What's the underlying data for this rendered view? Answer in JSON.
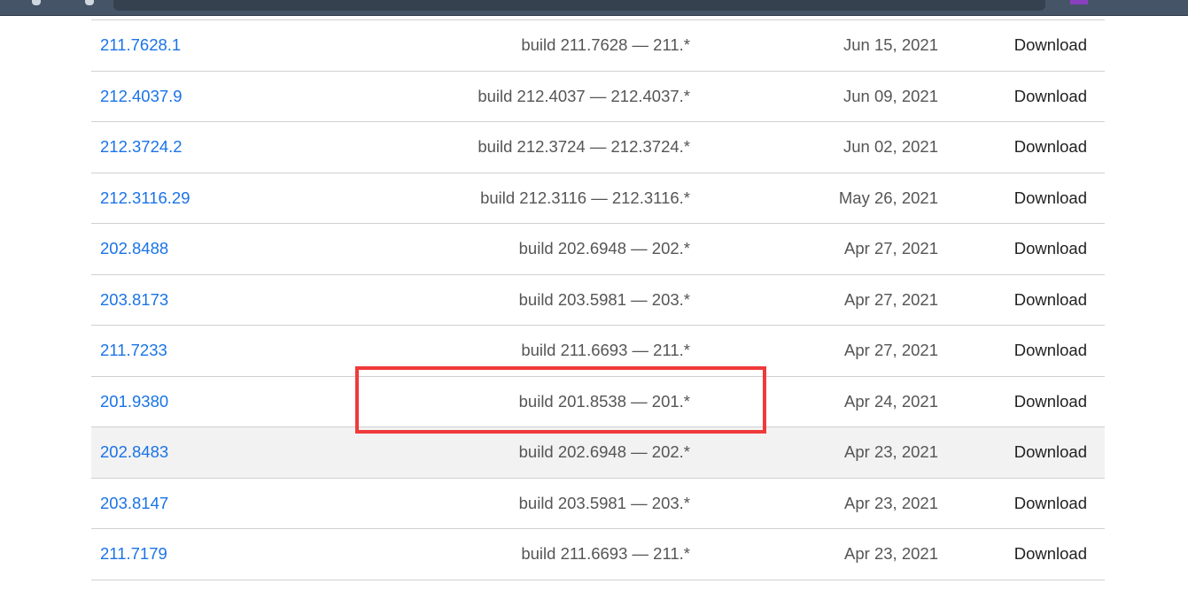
{
  "rows": [
    {
      "version": "211.7628.1",
      "build": "build 211.7628 — 211.*",
      "date": "Jun 15, 2021",
      "action": "Download"
    },
    {
      "version": "212.4037.9",
      "build": "build 212.4037 — 212.4037.*",
      "date": "Jun 09, 2021",
      "action": "Download"
    },
    {
      "version": "212.3724.2",
      "build": "build 212.3724 — 212.3724.*",
      "date": "Jun 02, 2021",
      "action": "Download"
    },
    {
      "version": "212.3116.29",
      "build": "build 212.3116 — 212.3116.*",
      "date": "May 26, 2021",
      "action": "Download"
    },
    {
      "version": "202.8488",
      "build": "build 202.6948 — 202.*",
      "date": "Apr 27, 2021",
      "action": "Download"
    },
    {
      "version": "203.8173",
      "build": "build 203.5981 — 203.*",
      "date": "Apr 27, 2021",
      "action": "Download"
    },
    {
      "version": "211.7233",
      "build": "build 211.6693 — 211.*",
      "date": "Apr 27, 2021",
      "action": "Download"
    },
    {
      "version": "201.9380",
      "build": "build 201.8538 — 201.*",
      "date": "Apr 24, 2021",
      "action": "Download"
    },
    {
      "version": "202.8483",
      "build": "build 202.6948 — 202.*",
      "date": "Apr 23, 2021",
      "action": "Download"
    },
    {
      "version": "203.8147",
      "build": "build 203.5981 — 203.*",
      "date": "Apr 23, 2021",
      "action": "Download"
    },
    {
      "version": "211.7179",
      "build": "build 211.6693 — 211.*",
      "date": "Apr 23, 2021",
      "action": "Download"
    }
  ],
  "highlight_color": "#f03a3a"
}
